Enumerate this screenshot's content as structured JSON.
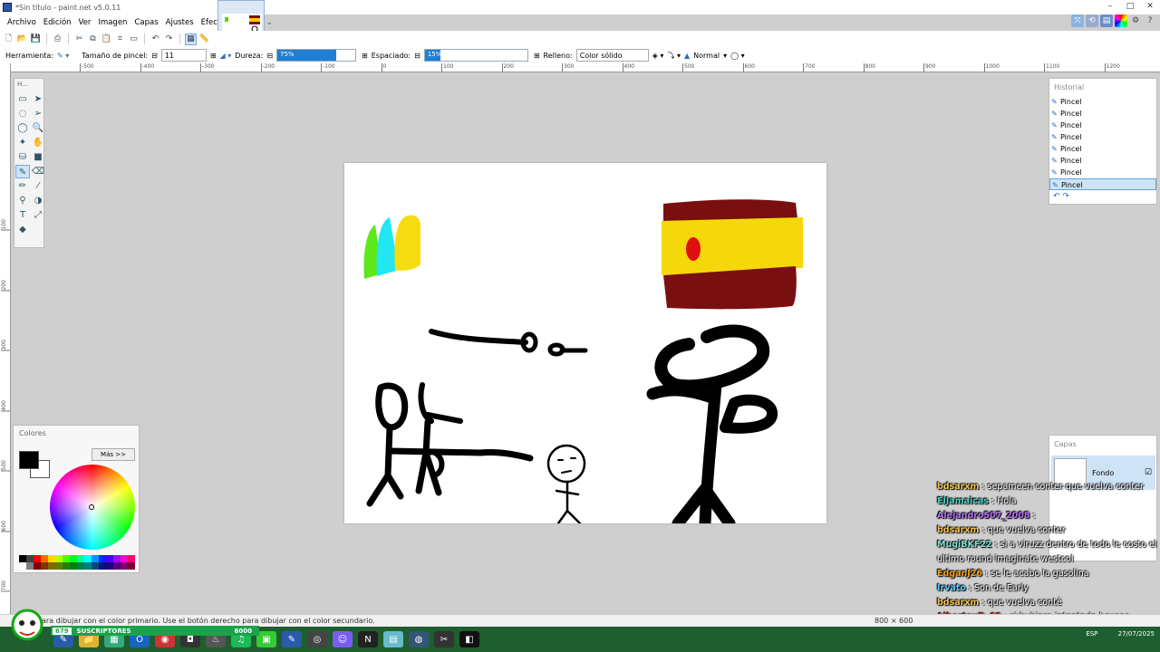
{
  "window": {
    "title": "*Sin título - paint.net v5.0.11",
    "controls": [
      "–",
      "□",
      "✕"
    ]
  },
  "menu": [
    "Archivo",
    "Edición",
    "Ver",
    "Imagen",
    "Capas",
    "Ajustes",
    "Efectos"
  ],
  "toolbar2": {
    "herramienta_label": "Herramienta:",
    "tamano_label": "Tamaño de pincel:",
    "tamano_value": "11",
    "dureza_label": "Dureza:",
    "dureza_value": "75%",
    "dureza_fraction": 0.75,
    "espaciado_label": "Espaciado:",
    "espaciado_value": "15%",
    "espaciado_fraction": 0.15,
    "relleno_label": "Relleno:",
    "relleno_value": "Color sólido",
    "blend_value": "Normal"
  },
  "ruler_h": [
    "-500",
    "-400",
    "-300",
    "-200",
    "-100",
    "0",
    "100",
    "200",
    "300",
    "400",
    "500",
    "600",
    "700",
    "800",
    "900",
    "1000",
    "1100",
    "1200"
  ],
  "ruler_v": [
    "100",
    "200",
    "300",
    "400",
    "500",
    "600",
    "700"
  ],
  "tools_panel": {
    "title": "H..."
  },
  "colors_panel": {
    "title": "Colores",
    "more_button": "Más >>",
    "primary": "#000000",
    "secondary": "#ffffff"
  },
  "history_panel": {
    "title": "Historial",
    "items": [
      "Pincel",
      "Pincel",
      "Pincel",
      "Pincel",
      "Pincel",
      "Pincel",
      "Pincel",
      "Pincel"
    ]
  },
  "layers_panel": {
    "title": "Capas",
    "layer_name": "Fondo"
  },
  "status": {
    "hint": "ara dibujar con el color primario. Use el botón derecho para dibujar con el color secundario.",
    "size": "800 × 600"
  },
  "stream_bar": {
    "count": "679",
    "label": "SUSCRIPTORES",
    "goal": "6000"
  },
  "chat": [
    {
      "user": "bdsarxm",
      "color": "#f2c14e",
      "msg": ": sepameen conter que vuelva conter"
    },
    {
      "user": "ElJamaicas",
      "color": "#4fd1c5",
      "msg": ": Hola"
    },
    {
      "user": "Alejandro507_2008",
      "color": "#b070f0",
      "msg": ":"
    },
    {
      "user": "bdsarxm",
      "color": "#f2c14e",
      "msg": ": que vuelva conter"
    },
    {
      "user": "MugiBKF22",
      "color": "#7fe0d0",
      "msg": ": si a viruzz dentro de todo le costo el ultimo round imaginate westcol"
    },
    {
      "user": "EdganJ26",
      "color": "#f0a020",
      "msg": ": se le acabo la gasolina"
    },
    {
      "user": "Irvato",
      "color": "#5ac8fa",
      "msg": ": Son de Early"
    },
    {
      "user": "bdsarxm",
      "color": "#f2c14e",
      "msg": ": que vuelva conté"
    },
    {
      "user": "AlbertoxD_69",
      "color": "#ff3030",
      "msg": ": si hubiera intentado boxear hubiera aguantado más el wachin"
    }
  ],
  "tray": {
    "lang": "ESP",
    "date": "27/07/2025"
  }
}
